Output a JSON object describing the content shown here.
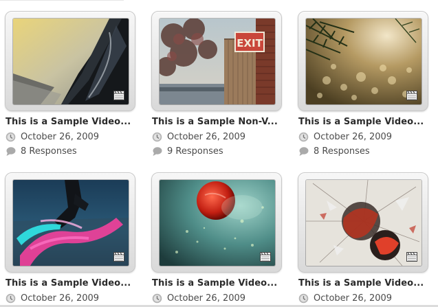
{
  "posts": [
    {
      "title": "This is a Sample Video...",
      "date": "October 26, 2009",
      "responses": "8 Responses",
      "thumb": "road-mirror"
    },
    {
      "title": "This is a Sample Non-V...",
      "date": "October 26, 2009",
      "responses": "9 Responses",
      "thumb": "exit-sign"
    },
    {
      "title": "This is a Sample Video...",
      "date": "October 26, 2009",
      "responses": "8 Responses",
      "thumb": "pine-bokeh"
    },
    {
      "title": "This is a Sample Video...",
      "date": "October 26, 2009",
      "responses": "",
      "thumb": "neon-dancer"
    },
    {
      "title": "This is a Sample Video...",
      "date": "October 26, 2009",
      "responses": "",
      "thumb": "red-planet"
    },
    {
      "title": "This is a Sample Video...",
      "date": "October 26, 2009",
      "responses": "",
      "thumb": "shatter-burst"
    }
  ],
  "icons": {
    "date": "clock-icon",
    "responses": "speech-bubble-icon",
    "video": "film-clapper-icon"
  },
  "colors": {
    "title": "#2b2b2b",
    "meta": "#4a4a4a",
    "icon": "#a8a8a8"
  }
}
